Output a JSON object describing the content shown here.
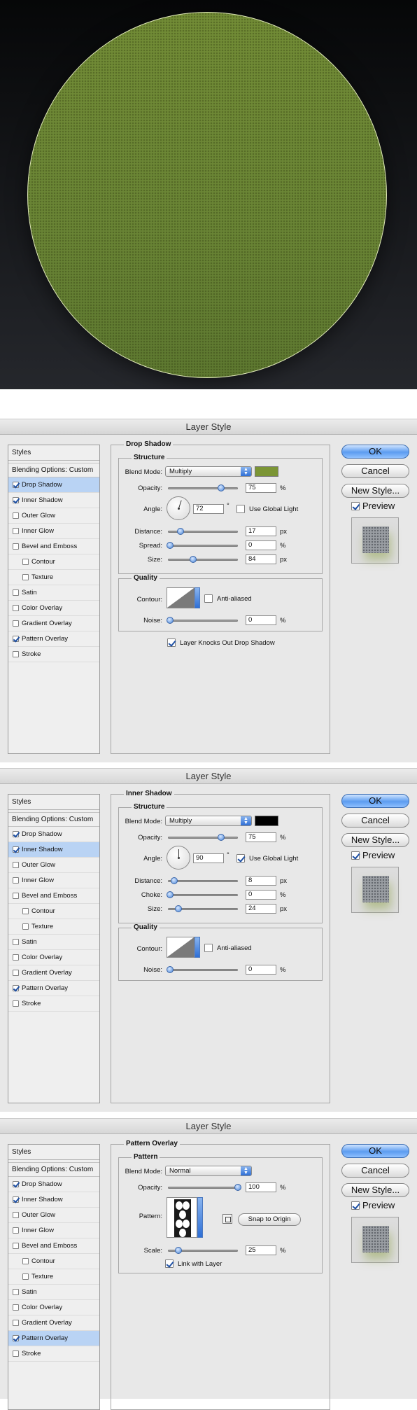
{
  "dialog_title": "Layer Style",
  "styles_header": "Styles",
  "blending_options": "Blending Options: Custom",
  "buttons": {
    "ok": "OK",
    "cancel": "Cancel",
    "new_style": "New Style...",
    "preview": "Preview"
  },
  "style_items": [
    "Drop Shadow",
    "Inner Shadow",
    "Outer Glow",
    "Inner Glow",
    "Bevel and Emboss",
    "Contour",
    "Texture",
    "Satin",
    "Color Overlay",
    "Gradient Overlay",
    "Pattern Overlay",
    "Stroke"
  ],
  "style_checked": [
    true,
    true,
    false,
    false,
    false,
    false,
    false,
    false,
    false,
    false,
    true,
    false
  ],
  "labels": {
    "structure": "Structure",
    "quality": "Quality",
    "pattern": "Pattern",
    "blend_mode": "Blend Mode:",
    "opacity": "Opacity:",
    "angle": "Angle:",
    "distance": "Distance:",
    "spread": "Spread:",
    "choke": "Choke:",
    "size": "Size:",
    "contour": "Contour:",
    "noise": "Noise:",
    "anti_aliased": "Anti-aliased",
    "use_global_light": "Use Global Light",
    "scale": "Scale:",
    "snap_to_origin": "Snap to Origin",
    "link_with_layer": "Link with Layer",
    "pattern_label": "Pattern:",
    "knocks_out": "Layer Knocks Out Drop Shadow"
  },
  "units": {
    "percent": "%",
    "px": "px",
    "degree": "°"
  },
  "drop_shadow": {
    "title": "Drop Shadow",
    "blend_mode": "Multiply",
    "color": "#7b9535",
    "opacity": "75",
    "angle": "72",
    "use_global_light": false,
    "distance": "17",
    "spread": "0",
    "size": "84",
    "anti_aliased": false,
    "noise": "0",
    "knocks_out": true,
    "sliders": {
      "opacity": 0.75,
      "distance": 0.17,
      "spread": 0.0,
      "size": 0.34,
      "noise": 0.0
    }
  },
  "inner_shadow": {
    "title": "Inner Shadow",
    "blend_mode": "Multiply",
    "color": "#000000",
    "opacity": "75",
    "angle": "90",
    "use_global_light": true,
    "distance": "8",
    "choke": "0",
    "size": "24",
    "anti_aliased": false,
    "noise": "0",
    "sliders": {
      "opacity": 0.75,
      "distance": 0.08,
      "choke": 0.0,
      "size": 0.14,
      "noise": 0.0
    }
  },
  "pattern_overlay": {
    "title": "Pattern Overlay",
    "blend_mode": "Normal",
    "opacity": "100",
    "scale": "25",
    "link_with_layer": true,
    "sliders": {
      "opacity": 1.0,
      "scale": 0.12
    }
  },
  "colors": {
    "circle_fill": "#6b8635",
    "selection": "#b9d3f4",
    "accent": "#3e7ee0"
  }
}
